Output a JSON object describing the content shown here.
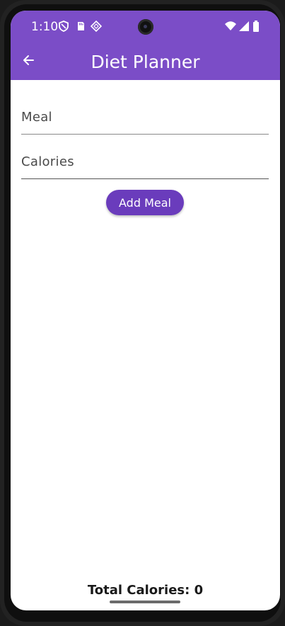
{
  "status_bar": {
    "time": "1:10",
    "icons": [
      "shield-icon",
      "sd-card-icon",
      "diamond-icon",
      "wifi-icon",
      "signal-icon",
      "battery-icon"
    ]
  },
  "app_bar": {
    "title": "Diet Planner",
    "back_icon": "arrow-left-icon",
    "color": "#7b4dc7"
  },
  "form": {
    "meal_placeholder": "Meal",
    "meal_value": "",
    "calories_placeholder": "Calories",
    "calories_value": "",
    "add_button_label": "Add Meal",
    "button_color": "#6a3cbc"
  },
  "footer": {
    "total_label": "Total Calories: 0"
  }
}
